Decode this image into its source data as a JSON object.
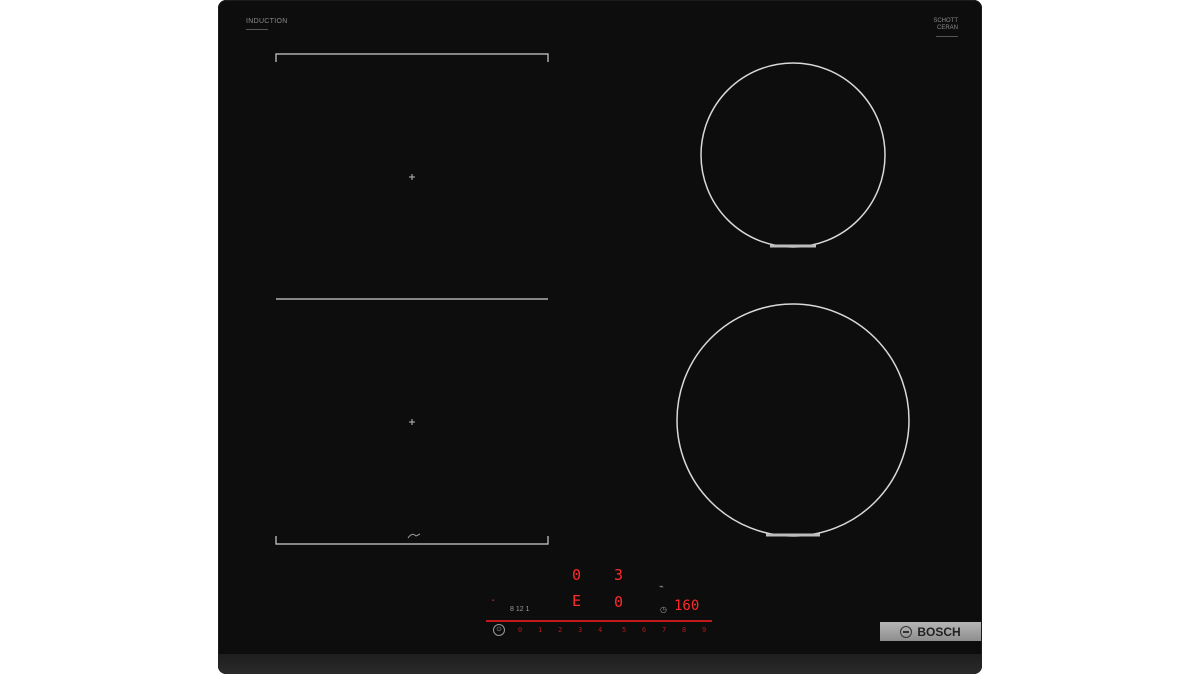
{
  "product": {
    "brand_left": "INDUCTION",
    "brand_right_line1": "SCHOTT",
    "brand_right_line2": "CERAN",
    "logo_text": "BOSCH"
  },
  "display": {
    "top_left_digit": "0",
    "top_right_digit": "3",
    "mid_left_digit": "E",
    "mid_right_digit": "0",
    "timer_value": "160",
    "timer_label": "8 12 1"
  },
  "slider": {
    "scale": [
      "0",
      "1",
      "2",
      "3",
      "4",
      "5",
      "6",
      "7",
      "8",
      "9"
    ]
  },
  "icons": [
    "power-icon",
    "plus-icon",
    "pan-icon",
    "bosch-logo-icon"
  ],
  "colors": {
    "glass": "#0d0d0d",
    "display_red": "#ff2a2a",
    "zone_outline": "#d9d9d9"
  }
}
